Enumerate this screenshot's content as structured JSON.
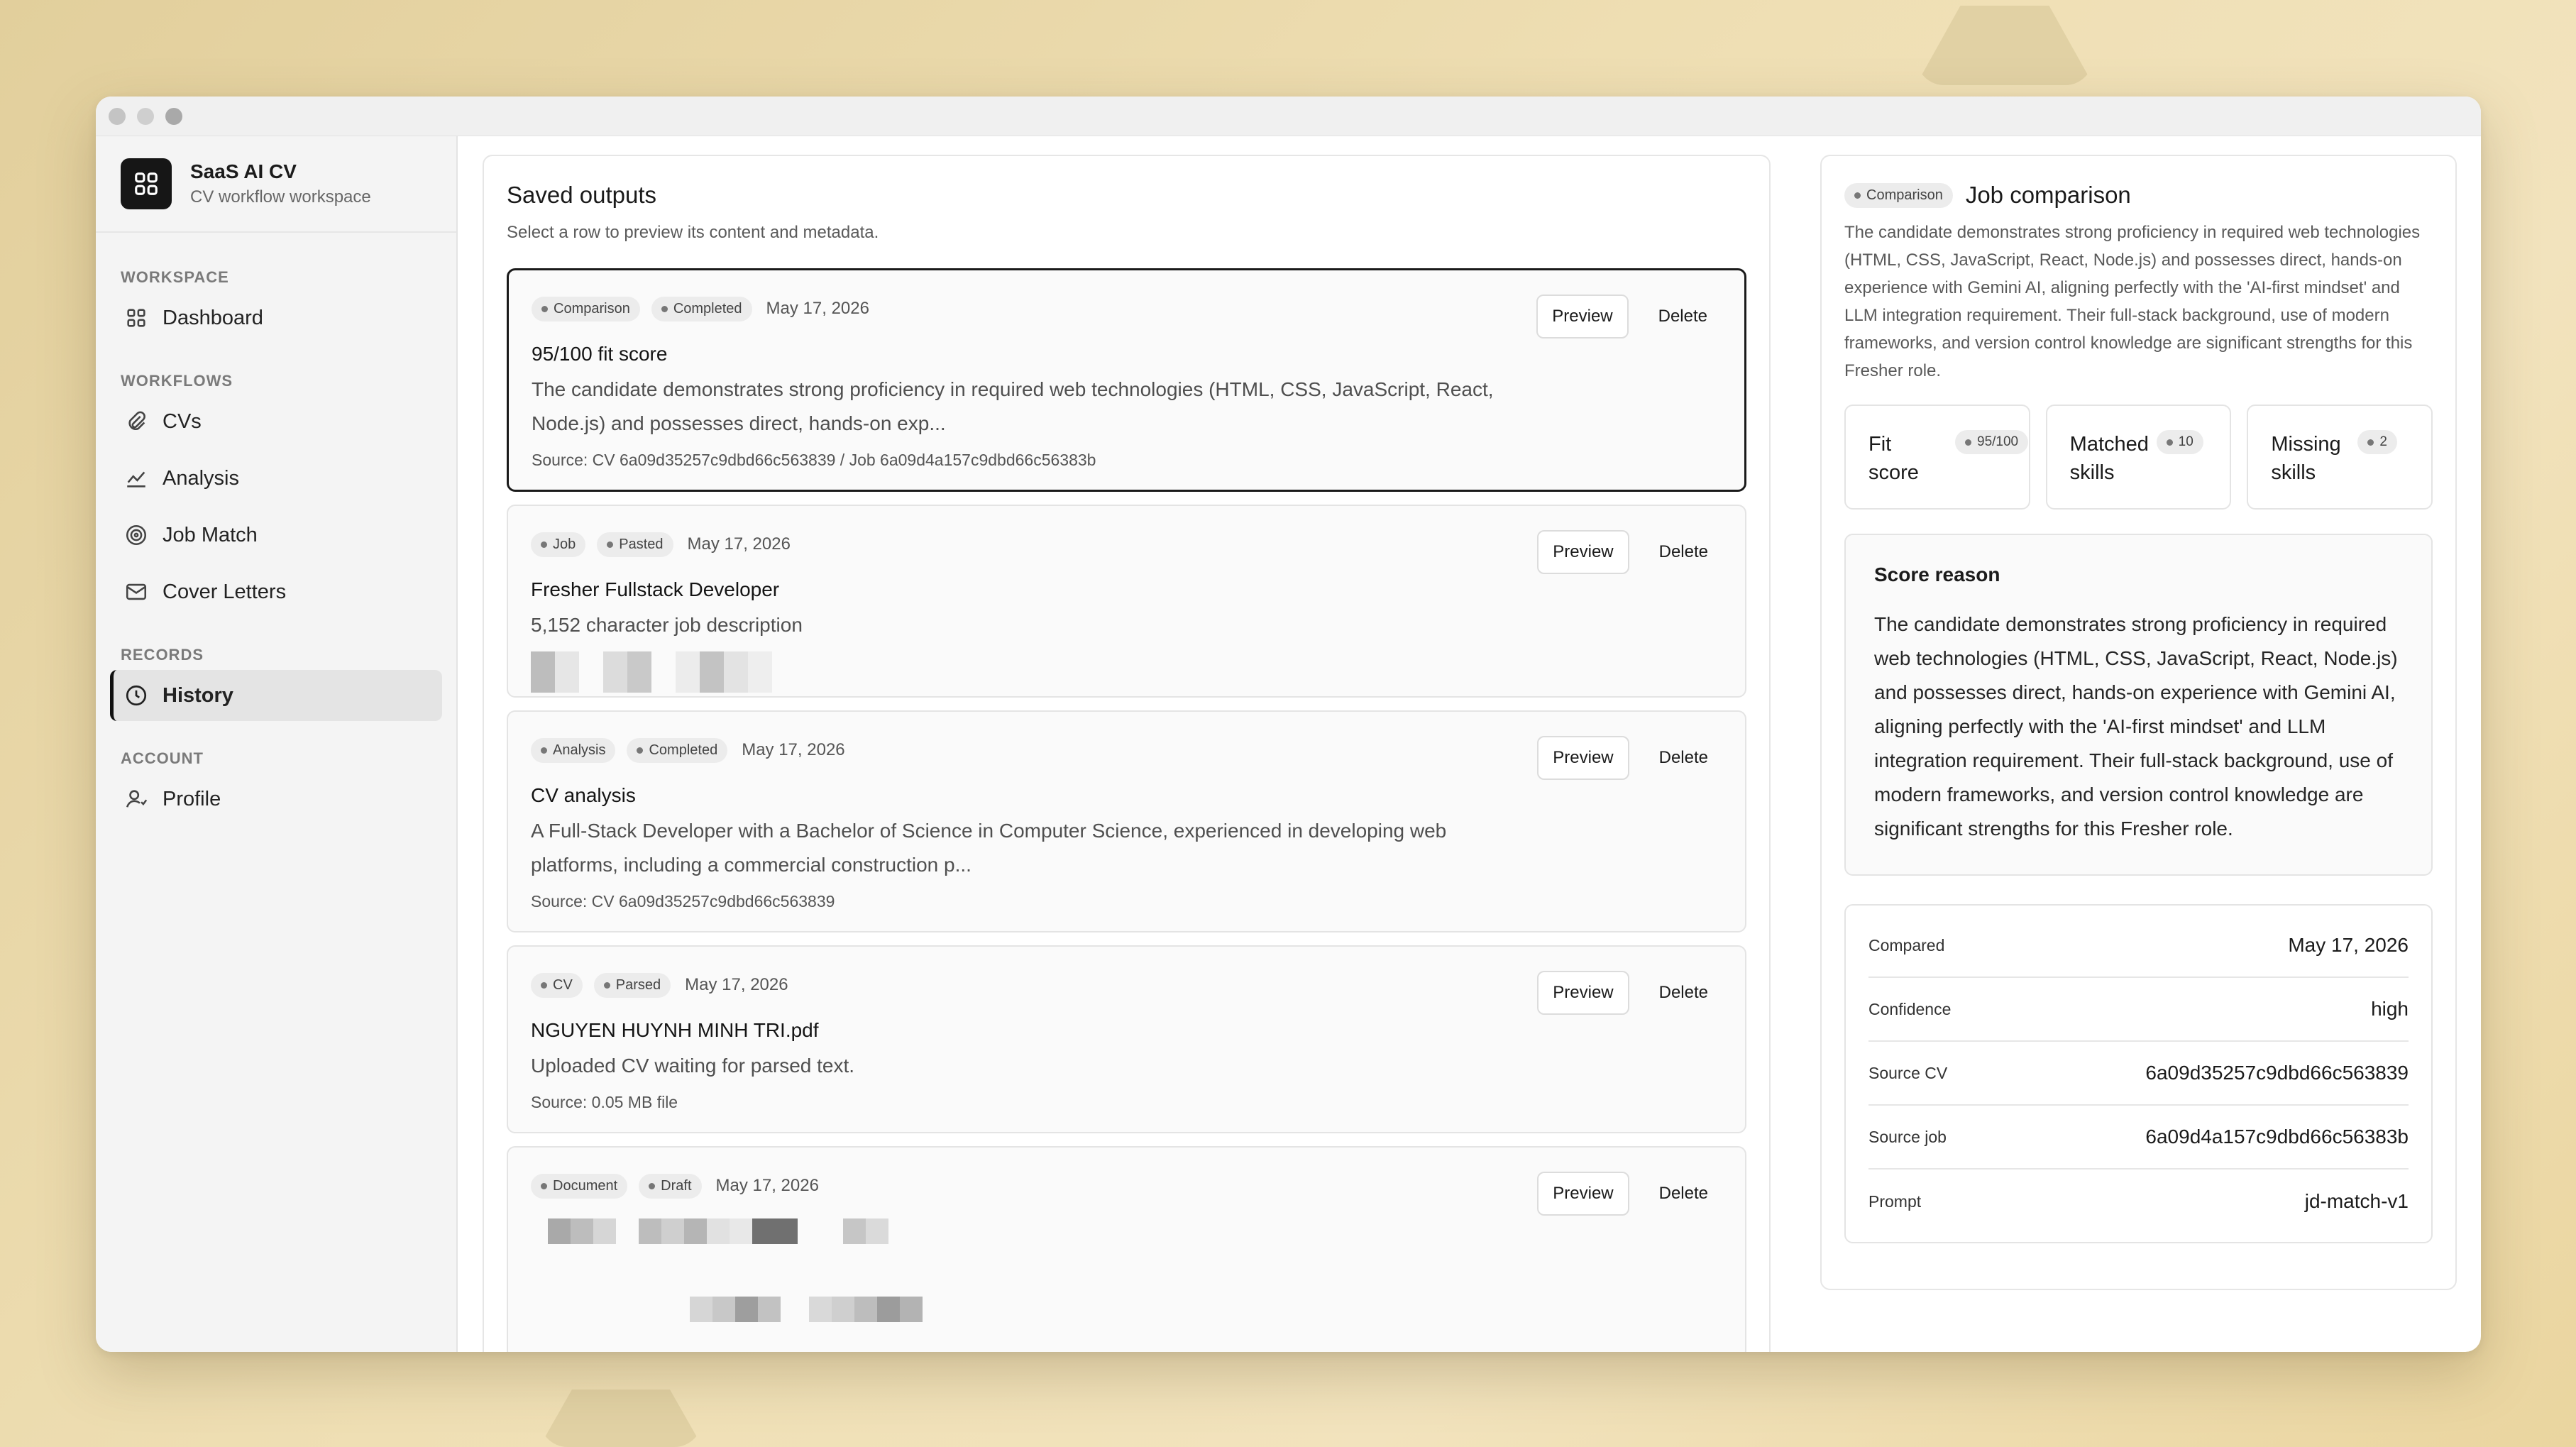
{
  "sidebar": {
    "brand_title": "SaaS AI CV",
    "brand_subtitle": "CV workflow workspace",
    "sections": {
      "workspace": "WORKSPACE",
      "workflows": "WORKFLOWS",
      "records": "RECORDS",
      "account": "ACCOUNT"
    },
    "items": {
      "dashboard": "Dashboard",
      "cvs": "CVs",
      "analysis": "Analysis",
      "job_match": "Job Match",
      "cover_letters": "Cover Letters",
      "history": "History",
      "profile": "Profile"
    },
    "active_item": "History"
  },
  "main": {
    "title": "Saved outputs",
    "subtitle": "Select a row to preview its content and metadata.",
    "preview_label": "Preview",
    "delete_label": "Delete",
    "cards": [
      {
        "type_badge": "Comparison",
        "status_badge": "Completed",
        "date": "May 17, 2026",
        "title": "95/100 fit score",
        "body": "The candidate demonstrates strong proficiency in required web technologies (HTML, CSS, JavaScript, React, Node.js) and possesses direct, hands-on exp...",
        "source": "Source: CV 6a09d35257c9dbd66c563839 / Job 6a09d4a157c9dbd66c56383b",
        "selected": true
      },
      {
        "type_badge": "Job",
        "status_badge": "Pasted",
        "date": "May 17, 2026",
        "title": "Fresher Fullstack Developer",
        "body": "5,152 character job description",
        "source": "",
        "selected": false
      },
      {
        "type_badge": "Analysis",
        "status_badge": "Completed",
        "date": "May 17, 2026",
        "title": "CV analysis",
        "body": "A Full-Stack Developer with a Bachelor of Science in Computer Science, experienced in developing web platforms, including a commercial construction p...",
        "source": "Source: CV 6a09d35257c9dbd66c563839",
        "selected": false
      },
      {
        "type_badge": "CV",
        "status_badge": "Parsed",
        "date": "May 17, 2026",
        "title": "NGUYEN HUYNH MINH TRI.pdf",
        "body": "Uploaded CV waiting for parsed text.",
        "source": "Source: 0.05 MB file",
        "selected": false
      },
      {
        "type_badge": "Document",
        "status_badge": "Draft",
        "date": "May 17, 2026",
        "title": "",
        "body": "",
        "source": "",
        "selected": false
      }
    ]
  },
  "detail": {
    "badge": "Comparison",
    "title": "Job comparison",
    "description": "The candidate demonstrates strong proficiency in required web technologies (HTML, CSS, JavaScript, React, Node.js) and possesses direct, hands-on experience with Gemini AI, aligning perfectly with the 'AI-first mindset' and LLM integration requirement. Their full-stack background, use of modern frameworks, and version control knowledge are significant strengths for this Fresher role.",
    "stats": [
      {
        "label": "Fit score",
        "value": "95/100"
      },
      {
        "label": "Matched skills",
        "value": "10"
      },
      {
        "label": "Missing skills",
        "value": "2"
      }
    ],
    "reason_title": "Score reason",
    "reason_body": "The candidate demonstrates strong proficiency in required web technologies (HTML, CSS, JavaScript, React, Node.js) and possesses direct, hands-on experience with Gemini AI, aligning perfectly with the 'AI-first mindset' and LLM integration requirement. Their full-stack background, use of modern frameworks, and version control knowledge are significant strengths for this Fresher role.",
    "meta": [
      {
        "key": "Compared",
        "value": "May 17, 2026"
      },
      {
        "key": "Confidence",
        "value": "high"
      },
      {
        "key": "Source CV",
        "value": "6a09d35257c9dbd66c563839"
      },
      {
        "key": "Source job",
        "value": "6a09d4a157c9dbd66c56383b"
      },
      {
        "key": "Prompt",
        "value": "jd-match-v1"
      }
    ]
  }
}
